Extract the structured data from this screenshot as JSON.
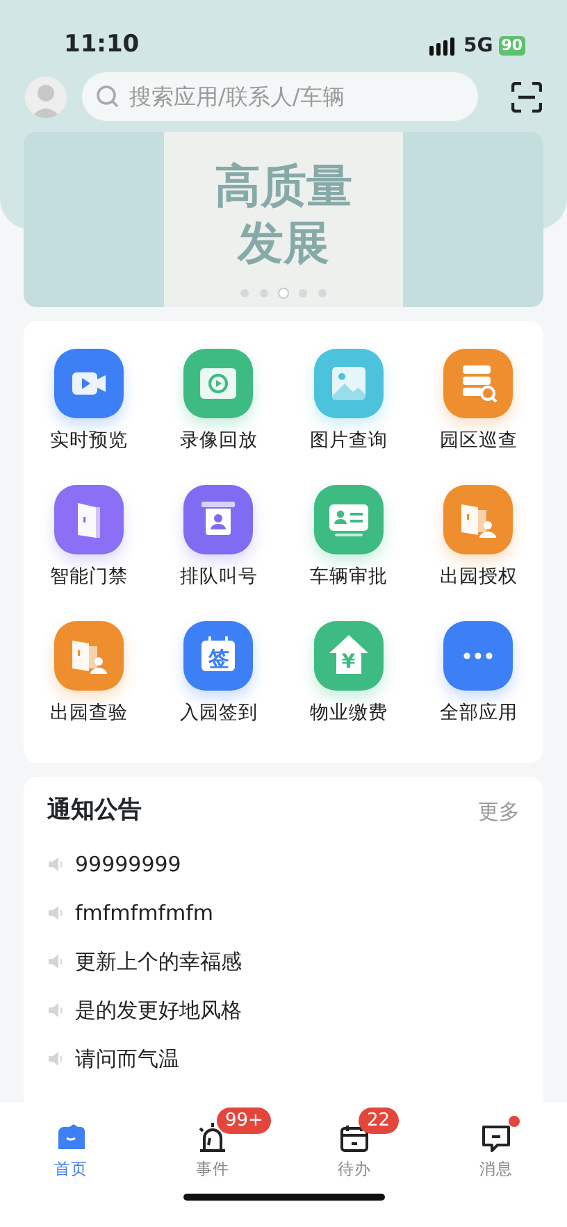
{
  "status_bar": {
    "time": "11:10",
    "network": "5G",
    "battery": "90"
  },
  "search": {
    "placeholder": "搜索应用/联系人/车辆"
  },
  "banner": {
    "lines": [
      "高质量",
      "发展"
    ],
    "dots": [
      {
        "selected": false
      },
      {
        "selected": false
      },
      {
        "selected": true
      },
      {
        "selected": false
      },
      {
        "selected": false
      }
    ]
  },
  "apps": [
    {
      "label": "实时预览",
      "kind": "camera",
      "color": "#3d7ff5"
    },
    {
      "label": "录像回放",
      "kind": "replay",
      "color": "#3dbb82"
    },
    {
      "label": "图片查询",
      "kind": "image",
      "color": "#4cc3dc"
    },
    {
      "label": "园区巡查",
      "kind": "server",
      "color": "#ee8e2e"
    },
    {
      "label": "智能门禁",
      "kind": "door",
      "color": "#8b6ff5"
    },
    {
      "label": "排队叫号",
      "kind": "queue",
      "color": "#7f6cf2"
    },
    {
      "label": "车辆审批",
      "kind": "card",
      "color": "#3dbb82"
    },
    {
      "label": "出园授权",
      "kind": "exit",
      "color": "#ee8e2e"
    },
    {
      "label": "出园查验",
      "kind": "exit",
      "color": "#ee8e2e"
    },
    {
      "label": "入园签到",
      "kind": "sign",
      "glyph": "签",
      "color": "#3d7ff5"
    },
    {
      "label": "物业缴费",
      "kind": "house",
      "glyph": "¥",
      "color": "#3dbb82"
    },
    {
      "label": "全部应用",
      "kind": "more",
      "color": "#3d7ff5"
    }
  ],
  "notices": {
    "title": "通知公告",
    "more": "更多",
    "items": [
      "99999999",
      "fmfmfmfmfm",
      "更新上个的幸福感",
      "是的发更好地风格",
      "请问而气温"
    ]
  },
  "tabs": [
    {
      "label": "首页",
      "kind": "home",
      "selected": true
    },
    {
      "label": "事件",
      "kind": "alarm",
      "selected": false,
      "badge": "99+"
    },
    {
      "label": "待办",
      "kind": "calendar",
      "selected": false,
      "badge": "22"
    },
    {
      "label": "消息",
      "kind": "message",
      "selected": false,
      "dot": true
    }
  ]
}
